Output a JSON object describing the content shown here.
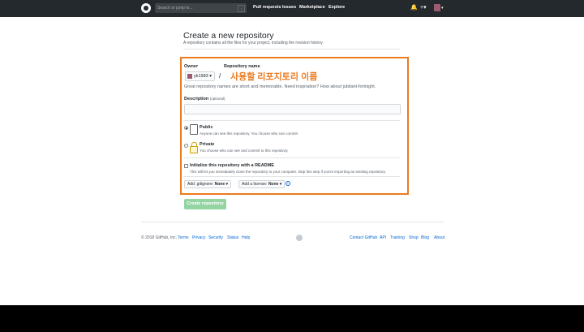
{
  "topbar": {
    "search_placeholder": "Search or jump to...",
    "search_key": "/",
    "nav": [
      "Pull requests",
      "Issues",
      "Marketplace",
      "Explore"
    ],
    "bell_icon": "bell-icon",
    "plus_label": "+▾",
    "avatar_caret": "▾"
  },
  "header": {
    "title": "Create a new repository",
    "subtitle": "A repository contains all the files for your project, including the revision history."
  },
  "form": {
    "owner_label": "Owner",
    "owner_value": "yk1983 ▾",
    "repo_label": "Repository name",
    "slash": "/",
    "repo_name_annotation": "사용할 리포지토리 이름",
    "hint": "Great repository names are short and memorable. Need inspiration? How about jubilant-fortnight.",
    "description_label": "Description",
    "description_optional": "(optional)",
    "public_title": "Public",
    "public_desc": "Anyone can see this repository. You choose who can commit.",
    "private_title": "Private",
    "private_desc": "You choose who can see and commit to this repository.",
    "readme_title": "Initialize this repository with a README",
    "readme_desc": "This will let you immediately clone the repository to your computer. Skip this step if you're importing an existing repository.",
    "gitignore_label": "Add .gitignore:",
    "gitignore_value": "None ▾",
    "license_label": "Add a license:",
    "license_value": "None ▾",
    "info_icon": "i",
    "create_button": "Create repository"
  },
  "footer": {
    "copyright": "© 2018 GitHub, Inc.",
    "left_links": [
      "Terms",
      "Privacy",
      "Security",
      "Status",
      "Help"
    ],
    "right_links": [
      "Contact GitHub",
      "API",
      "Training",
      "Shop",
      "Blog",
      "About"
    ]
  },
  "colors": {
    "annotation_orange": "#ec7a1f",
    "create_button_green": "#94d3a2",
    "topbar": "#24292e"
  }
}
